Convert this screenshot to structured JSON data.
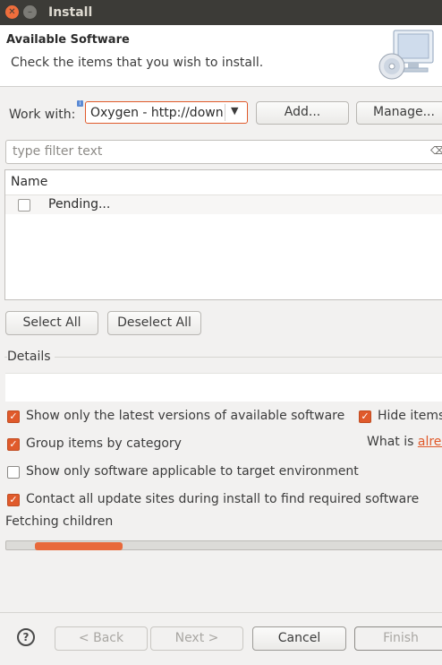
{
  "window": {
    "title": "Install"
  },
  "header": {
    "title": "Available Software",
    "subtitle": "Check the items that you wish to install."
  },
  "work_with": {
    "label": "Work with:",
    "value": "Oxygen - http://download.eclipse.org/releases/oxygen",
    "add_label": "Add...",
    "manage_label": "Manage..."
  },
  "filter": {
    "placeholder": "type filter text"
  },
  "table": {
    "column_name": "Name",
    "rows": [
      {
        "label": "Pending...",
        "checked": false
      }
    ]
  },
  "selection": {
    "select_all": "Select All",
    "deselect_all": "Deselect All"
  },
  "details": {
    "label": "Details"
  },
  "options": {
    "latest_versions": {
      "label": "Show only the latest versions of available software",
      "checked": true
    },
    "hide_items": {
      "label": "Hide items that are already installed",
      "checked": true
    },
    "group_by_category": {
      "label": "Group items by category",
      "checked": true
    },
    "what_is_prefix": "What is ",
    "what_is_link": "already installed",
    "target_env": {
      "label": "Show only software applicable to target environment",
      "checked": false
    },
    "contact_sites": {
      "label": "Contact all update sites during install to find required software",
      "checked": true
    }
  },
  "status": {
    "text": "Fetching children",
    "progress": 0.2
  },
  "footer": {
    "help": "?",
    "back": "< Back",
    "next": "Next >",
    "cancel": "Cancel",
    "finish": "Finish"
  },
  "colors": {
    "accent": "#e05a2b",
    "titlebar": "#3c3b37",
    "progress": "#e8693b"
  }
}
